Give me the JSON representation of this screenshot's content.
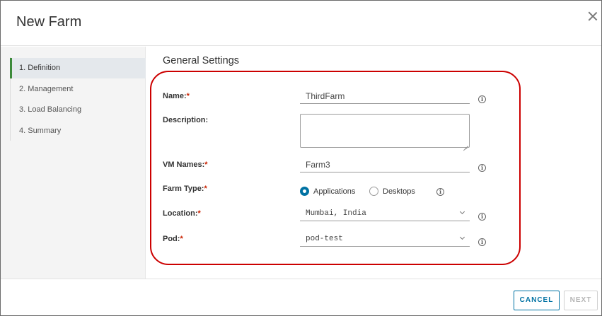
{
  "dialog": {
    "title": "New Farm"
  },
  "sidebar": {
    "steps": [
      {
        "label": "1. Definition",
        "active": true
      },
      {
        "label": "2. Management",
        "active": false
      },
      {
        "label": "3. Load Balancing",
        "active": false
      },
      {
        "label": "4. Summary",
        "active": false
      }
    ]
  },
  "form": {
    "section_title": "General Settings",
    "required_marker": "*",
    "name": {
      "label": "Name:",
      "value": "ThirdFarm"
    },
    "description": {
      "label": "Description:",
      "value": ""
    },
    "vm_names": {
      "label": "VM Names:",
      "value": "Farm3"
    },
    "farm_type": {
      "label": "Farm Type:",
      "options": [
        {
          "label": "Applications",
          "selected": true
        },
        {
          "label": "Desktops",
          "selected": false
        }
      ]
    },
    "location": {
      "label": "Location:",
      "value": "Mumbai, India"
    },
    "pod": {
      "label": "Pod:",
      "value": "pod-test"
    },
    "info_glyph": "i"
  },
  "footer": {
    "cancel_label": "CANCEL",
    "next_label": "NEXT"
  },
  "colors": {
    "accent": "#0072a3",
    "active_step_bar": "#3c8a3a",
    "highlight_outline": "#cc0000",
    "required": "#c92100"
  }
}
